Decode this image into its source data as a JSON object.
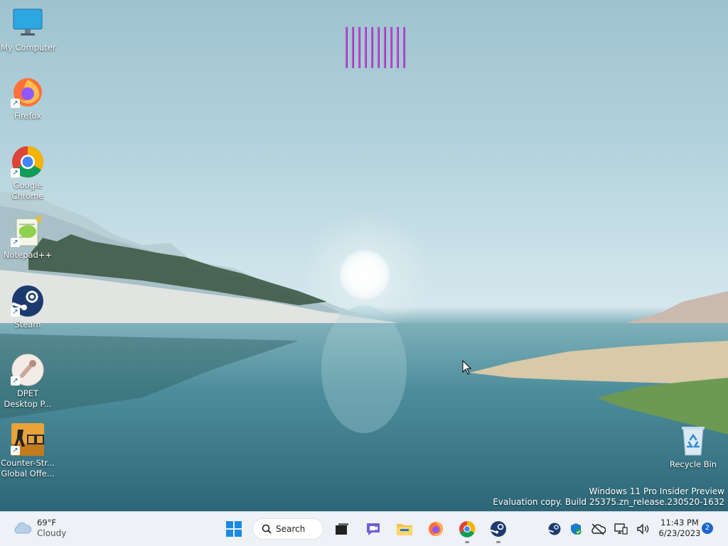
{
  "desktop": {
    "icons": [
      {
        "label1": "My Computer",
        "label2": ""
      },
      {
        "label1": "Firefox",
        "label2": ""
      },
      {
        "label1": "Google",
        "label2": "Chrome"
      },
      {
        "label1": "Notepad++",
        "label2": ""
      },
      {
        "label1": "Steam",
        "label2": ""
      },
      {
        "label1": "DPET",
        "label2": "Desktop P..."
      },
      {
        "label1": "Counter-Str...",
        "label2": "Global Offe..."
      },
      {
        "label1": "Recycle Bin",
        "label2": ""
      }
    ],
    "watermark": {
      "line1": "Windows 11 Pro Insider Preview",
      "line2": "Evaluation copy. Build 25375.zn_release.230520-1632"
    }
  },
  "taskbar": {
    "weather": {
      "temp": "69°F",
      "condition": "Cloudy",
      "icon": "cloud-icon"
    },
    "search_label": "Search",
    "pinned": [
      "start-icon",
      "task-view-icon",
      "teams-chat-icon",
      "file-explorer-icon",
      "firefox-icon",
      "chrome-icon",
      "steam-icon"
    ],
    "tray": [
      "steam-tray-icon",
      "security-shield-icon",
      "onedrive-offline-icon",
      "network-icon",
      "volume-icon"
    ],
    "clock": {
      "time": "11:43 PM",
      "date": "6/23/2023"
    },
    "notifications": "2"
  },
  "colors": {
    "accent": "#1a66d2",
    "taskbar": "#eef1f5"
  }
}
